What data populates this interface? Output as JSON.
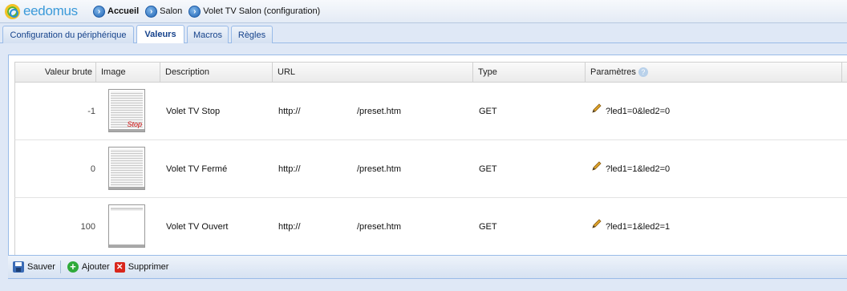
{
  "app": {
    "name": "eedomus"
  },
  "breadcrumb": [
    {
      "label": "Accueil",
      "bold": true
    },
    {
      "label": "Salon",
      "bold": false
    },
    {
      "label": "Volet TV Salon (configuration)",
      "bold": false
    }
  ],
  "tabs": [
    {
      "label": "Configuration du périphérique",
      "active": false
    },
    {
      "label": "Valeurs",
      "active": true
    },
    {
      "label": "Macros",
      "active": false
    },
    {
      "label": "Règles",
      "active": false
    }
  ],
  "grid": {
    "columns": [
      "Valeur brute",
      "Image",
      "Description",
      "URL",
      "Type",
      "Paramètres"
    ],
    "rows": [
      {
        "value": "-1",
        "image": "shutter-stop",
        "image_label": "Stop",
        "description": "Volet TV Stop",
        "url_prefix": "http://",
        "url_suffix": "/preset.htm",
        "type": "GET",
        "params": "?led1=0&led2=0"
      },
      {
        "value": "0",
        "image": "shutter-closed",
        "image_label": "",
        "description": "Volet TV Fermé",
        "url_prefix": "http://",
        "url_suffix": "/preset.htm",
        "type": "GET",
        "params": "?led1=1&led2=0"
      },
      {
        "value": "100",
        "image": "shutter-open",
        "image_label": "",
        "description": "Volet TV Ouvert",
        "url_prefix": "http://",
        "url_suffix": "/preset.htm",
        "type": "GET",
        "params": "?led1=1&led2=1"
      }
    ]
  },
  "toolbar": {
    "save_label": "Sauver",
    "add_label": "Ajouter",
    "delete_label": "Supprimer"
  },
  "icons": {
    "nav": "arrow-right-circle-icon",
    "help": "question-icon",
    "edit": "pencil-icon",
    "save": "floppy-disk-icon",
    "add": "plus-circle-icon",
    "delete": "x-square-icon"
  },
  "colors": {
    "accent": "#15428b",
    "border": "#99bbe8",
    "stop_label": "#d21010"
  }
}
